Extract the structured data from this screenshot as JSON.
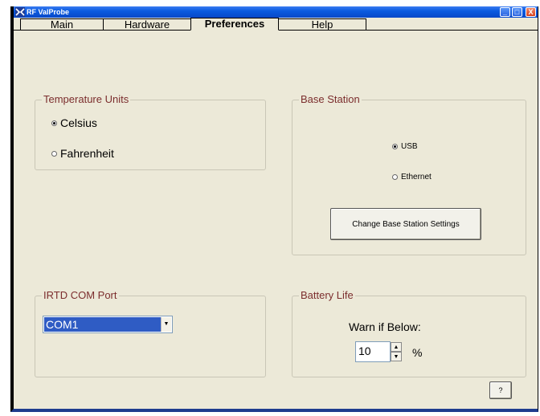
{
  "window": {
    "title": "RF ValProbe",
    "minimize_glyph": "_",
    "maximize_glyph": "□",
    "close_glyph": "X"
  },
  "tabs": [
    {
      "label": "Main",
      "active": false
    },
    {
      "label": "Hardware",
      "active": false
    },
    {
      "label": "Preferences",
      "active": true
    },
    {
      "label": "Help",
      "active": false
    }
  ],
  "temperature_units": {
    "title": "Temperature Units",
    "options": [
      {
        "label": "Celsius",
        "selected": true
      },
      {
        "label": "Fahrenheit",
        "selected": false
      }
    ]
  },
  "base_station": {
    "title": "Base Station",
    "options": [
      {
        "label": "USB",
        "selected": true
      },
      {
        "label": "Ethernet",
        "selected": false
      }
    ],
    "change_button": "Change Base Station Settings"
  },
  "irtd_com_port": {
    "title": "IRTD COM Port",
    "selected": "COM1"
  },
  "battery_life": {
    "title": "Battery Life",
    "warn_label": "Warn if Below:",
    "value": "10",
    "unit": "%"
  },
  "help_button": "?",
  "colors": {
    "titlebar": "#0a5be0",
    "group_label": "#7b2d2d",
    "panel_bg": "#ece9d8",
    "combo_highlight": "#2f5cc4"
  }
}
